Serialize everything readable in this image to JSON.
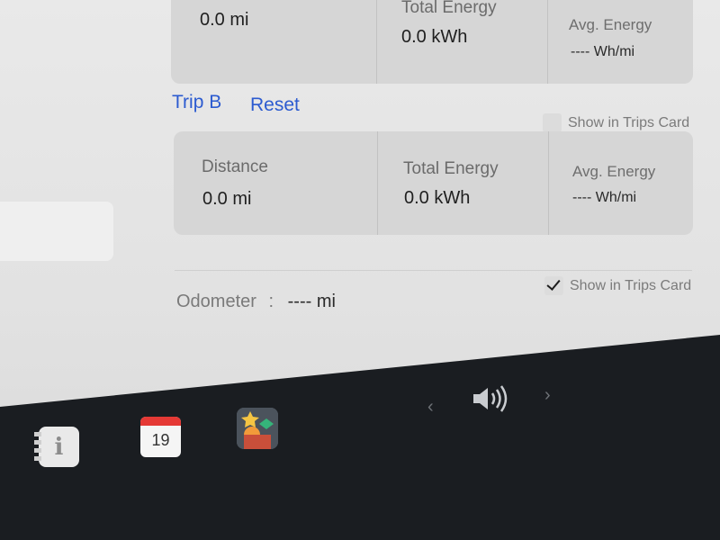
{
  "trip_a": {
    "distance_value": "0.0  mi",
    "energy_label": "Total Energy",
    "energy_value": "0.0  kWh",
    "avg_label": "Avg. Energy",
    "avg_value": "----  Wh/mi"
  },
  "trip_b": {
    "title": "Trip B",
    "reset_label": "Reset",
    "show_in_trips_label": "Show in Trips Card",
    "show_in_trips_checked": false,
    "distance_label": "Distance",
    "distance_value": "0.0  mi",
    "energy_label": "Total Energy",
    "energy_value": "0.0  kWh",
    "avg_label": "Avg. Energy",
    "avg_value": "----  Wh/mi"
  },
  "odometer": {
    "label": "Odometer",
    "separator": ":",
    "value": "----  mi",
    "show_in_trips_label": "Show in Trips Card",
    "show_in_trips_checked": true
  },
  "dock": {
    "calendar_day": "19",
    "icons": [
      "notes-icon",
      "calendar-icon",
      "game-icon",
      "chevron-left-icon",
      "volume-icon",
      "chevron-right-icon"
    ]
  },
  "colors": {
    "accent": "#2c5bd0",
    "card": "#d6d6d6",
    "screen": "#e6e6e6",
    "calendar_red": "#e53935"
  }
}
